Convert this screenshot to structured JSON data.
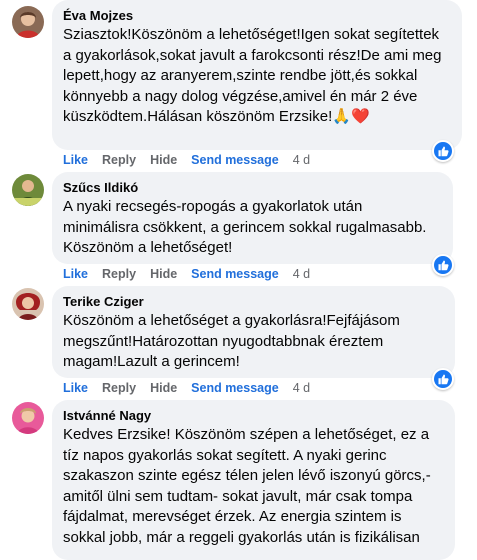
{
  "comments": [
    {
      "author": "Éva Mojzes",
      "text": "Sziasztok!Köszönöm a lehetőséget!Igen sokat segítettek a gyakorlások,sokat javult a farokcsonti rész!De ami meg lepett,hogy az aranyerem,szinte rendbe jött,és sokkal könnyebb a nagy dolog végzése,amivel én már 2 éve küszködtem.Hálásan köszönöm Erzsike!",
      "emoji": "🙏❤️",
      "actions": {
        "like": "Like",
        "reply": "Reply",
        "hide": "Hide",
        "send": "Send message",
        "age": "4 d"
      }
    },
    {
      "author": "Szűcs Ildikó",
      "text": "A nyaki recsegés-ropogás a gyakorlatok után minimálisra csökkent, a gerincem sokkal rugalmasabb. Köszönöm a lehetőséget!",
      "actions": {
        "like": "Like",
        "reply": "Reply",
        "hide": "Hide",
        "send": "Send message",
        "age": "4 d"
      }
    },
    {
      "author": "Terike Cziger",
      "text": "Köszönöm a lehetőséget a gyakorlásra!Fejfájásom megszűnt!Határozottan nyugodtabbnak éreztem magam!Lazult a gerincem!",
      "actions": {
        "like": "Like",
        "reply": "Reply",
        "hide": "Hide",
        "send": "Send message",
        "age": "4 d"
      }
    },
    {
      "author": "Istvánné Nagy",
      "text": "Kedves Erzsike! Köszönöm szépen a lehetőséget, ez a tíz napos gyakorlás sokat segített. A nyaki gerinc szakaszon szinte egész télen jelen lévő iszonyú görcs,-amitől ülni sem tudtam- sokat javult, már csak tompa fájdalmat, merevséget érzek. Az energia szintem is sokkal jobb, már a reggeli gyakorlás után is fizikálisan"
    }
  ],
  "colors": {
    "bubble": "#f0f2f5",
    "link": "#216fdb",
    "muted": "#65676b",
    "like_badge": "#1877f2"
  },
  "icons": {
    "reaction": "thumbs-up-icon"
  }
}
